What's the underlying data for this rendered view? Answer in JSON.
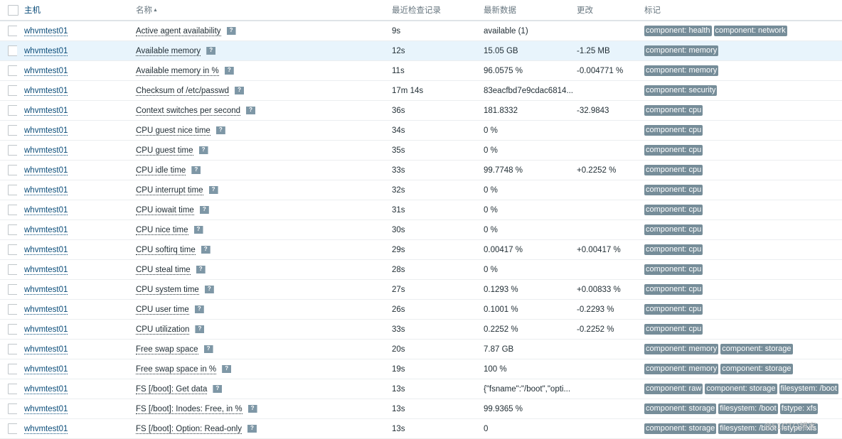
{
  "table": {
    "headers": {
      "host": "主机",
      "name": "名称",
      "sort_indicator": "▲",
      "last_check": "最近检查记录",
      "last_value": "最新数据",
      "change": "更改",
      "tags": "标记"
    },
    "hint_icon": "?",
    "rows": [
      {
        "host": "whvmtest01",
        "name": "Active agent availability",
        "last_check": "9s",
        "last_value": "available (1)",
        "change": "",
        "tags": [
          "component: health",
          "component: network"
        ]
      },
      {
        "host": "whvmtest01",
        "name": "Available memory",
        "last_check": "12s",
        "last_value": "15.05 GB",
        "change": "-1.25 MB",
        "tags": [
          "component: memory"
        ]
      },
      {
        "host": "whvmtest01",
        "name": "Available memory in %",
        "last_check": "11s",
        "last_value": "96.0575 %",
        "change": "-0.004771 %",
        "tags": [
          "component: memory"
        ]
      },
      {
        "host": "whvmtest01",
        "name": "Checksum of /etc/passwd",
        "last_check": "17m 14s",
        "last_value": "83eacfbd7e9cdac6814...",
        "change": "",
        "tags": [
          "component: security"
        ]
      },
      {
        "host": "whvmtest01",
        "name": "Context switches per second",
        "last_check": "36s",
        "last_value": "181.8332",
        "change": "-32.9843",
        "tags": [
          "component: cpu"
        ]
      },
      {
        "host": "whvmtest01",
        "name": "CPU guest nice time",
        "last_check": "34s",
        "last_value": "0 %",
        "change": "",
        "tags": [
          "component: cpu"
        ]
      },
      {
        "host": "whvmtest01",
        "name": "CPU guest time",
        "last_check": "35s",
        "last_value": "0 %",
        "change": "",
        "tags": [
          "component: cpu"
        ]
      },
      {
        "host": "whvmtest01",
        "name": "CPU idle time",
        "last_check": "33s",
        "last_value": "99.7748 %",
        "change": "+0.2252 %",
        "tags": [
          "component: cpu"
        ]
      },
      {
        "host": "whvmtest01",
        "name": "CPU interrupt time",
        "last_check": "32s",
        "last_value": "0 %",
        "change": "",
        "tags": [
          "component: cpu"
        ]
      },
      {
        "host": "whvmtest01",
        "name": "CPU iowait time",
        "last_check": "31s",
        "last_value": "0 %",
        "change": "",
        "tags": [
          "component: cpu"
        ]
      },
      {
        "host": "whvmtest01",
        "name": "CPU nice time",
        "last_check": "30s",
        "last_value": "0 %",
        "change": "",
        "tags": [
          "component: cpu"
        ]
      },
      {
        "host": "whvmtest01",
        "name": "CPU softirq time",
        "last_check": "29s",
        "last_value": "0.00417 %",
        "change": "+0.00417 %",
        "tags": [
          "component: cpu"
        ]
      },
      {
        "host": "whvmtest01",
        "name": "CPU steal time",
        "last_check": "28s",
        "last_value": "0 %",
        "change": "",
        "tags": [
          "component: cpu"
        ]
      },
      {
        "host": "whvmtest01",
        "name": "CPU system time",
        "last_check": "27s",
        "last_value": "0.1293 %",
        "change": "+0.00833 %",
        "tags": [
          "component: cpu"
        ]
      },
      {
        "host": "whvmtest01",
        "name": "CPU user time",
        "last_check": "26s",
        "last_value": "0.1001 %",
        "change": "-0.2293 %",
        "tags": [
          "component: cpu"
        ]
      },
      {
        "host": "whvmtest01",
        "name": "CPU utilization",
        "last_check": "33s",
        "last_value": "0.2252 %",
        "change": "-0.2252 %",
        "tags": [
          "component: cpu"
        ]
      },
      {
        "host": "whvmtest01",
        "name": "Free swap space",
        "last_check": "20s",
        "last_value": "7.87 GB",
        "change": "",
        "tags": [
          "component: memory",
          "component: storage"
        ]
      },
      {
        "host": "whvmtest01",
        "name": "Free swap space in %",
        "last_check": "19s",
        "last_value": "100 %",
        "change": "",
        "tags": [
          "component: memory",
          "component: storage"
        ]
      },
      {
        "host": "whvmtest01",
        "name": "FS [/boot]: Get data",
        "last_check": "13s",
        "last_value": "{\"fsname\":\"/boot\",\"opti...",
        "change": "",
        "tags": [
          "component: raw",
          "component: storage",
          "filesystem: /boot"
        ]
      },
      {
        "host": "whvmtest01",
        "name": "FS [/boot]: Inodes: Free, in %",
        "last_check": "13s",
        "last_value": "99.9365 %",
        "change": "",
        "tags": [
          "component: storage",
          "filesystem: /boot",
          "fstype: xfs"
        ]
      },
      {
        "host": "whvmtest01",
        "name": "FS [/boot]: Option: Read-only",
        "last_check": "13s",
        "last_value": "0",
        "change": "",
        "tags": [
          "component: storage",
          "filesystem: /boot",
          "fstype: xfs"
        ]
      }
    ],
    "highlighted_row": 1
  },
  "watermark": "@51CTO博客"
}
